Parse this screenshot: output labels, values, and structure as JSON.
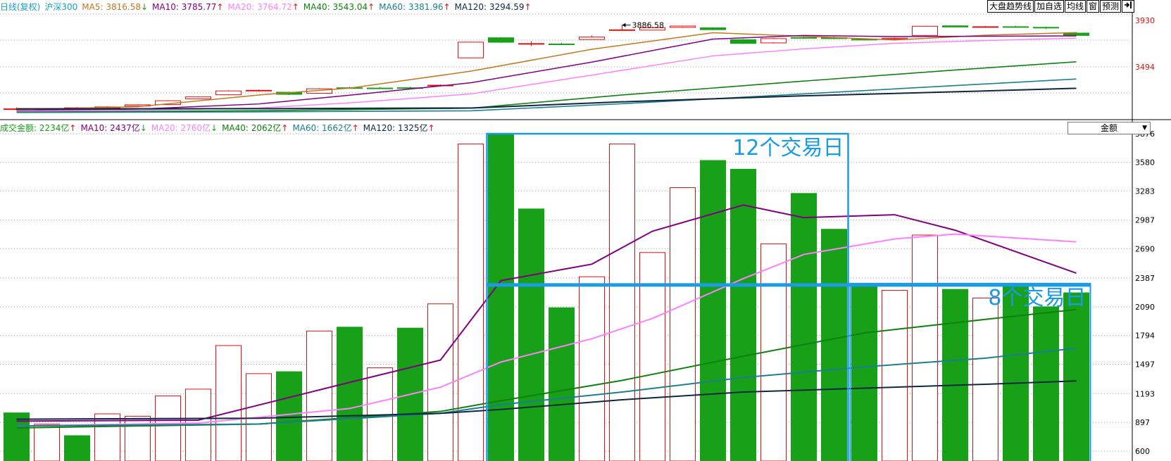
{
  "price_legend": [
    {
      "text": "日线(复权)",
      "color": "#1aa0c8",
      "arrow": "",
      "arrow_color": ""
    },
    {
      "text": "沪深300",
      "color": "#1aa0c8",
      "arrow": "",
      "arrow_color": ""
    },
    {
      "text": "MA5: 3816.58",
      "color": "#c07820",
      "arrow": "↓",
      "arrow_color": "#18a018"
    },
    {
      "text": "MA10: 3785.77",
      "color": "#800080",
      "arrow": "↑",
      "arrow_color": "#e01010"
    },
    {
      "text": "MA20: 3764.72",
      "color": "#ff80ff",
      "arrow": "↑",
      "arrow_color": "#e01010"
    },
    {
      "text": "MA40: 3543.04",
      "color": "#108010",
      "arrow": "↑",
      "arrow_color": "#e01010"
    },
    {
      "text": "MA60: 3381.96",
      "color": "#1a8090",
      "arrow": "↑",
      "arrow_color": "#e01010"
    },
    {
      "text": "MA120: 3294.59",
      "color": "#102840",
      "arrow": "↑",
      "arrow_color": "#e01010"
    }
  ],
  "volume_legend": [
    {
      "text": "成交金额: 2234亿",
      "color": "#18a018",
      "arrow": "↑",
      "arrow_color": "#e01010"
    },
    {
      "text": "MA10: 2437亿",
      "color": "#800080",
      "arrow": "↓",
      "arrow_color": "#18a018"
    },
    {
      "text": "MA20: 2760亿",
      "color": "#ff80ff",
      "arrow": "↓",
      "arrow_color": "#18a018"
    },
    {
      "text": "MA40: 2062亿",
      "color": "#108010",
      "arrow": "↑",
      "arrow_color": "#e01010"
    },
    {
      "text": "MA60: 1662亿",
      "color": "#1a8090",
      "arrow": "↑",
      "arrow_color": "#e01010"
    },
    {
      "text": "MA120: 1325亿",
      "color": "#102840",
      "arrow": "↑",
      "arrow_color": "#e01010"
    }
  ],
  "toolbar": {
    "trend_label": "大盘趋势线",
    "add_watch_label": "加自选",
    "avg_line_label": "均线",
    "window_label": "窗",
    "forecast_label": "预测",
    "exit_icon": "exit-arrow-icon"
  },
  "amount_select": {
    "value": "金额"
  },
  "colors": {
    "up": "#e01010",
    "down": "#18a018",
    "grid": "#a0a0a0",
    "axis_label": "#e01010",
    "annotation": "#1a9be6",
    "ma5": "#c07820",
    "ma10": "#800080",
    "ma20": "#ff80ff",
    "ma40": "#108010",
    "ma60": "#1a8090",
    "ma120": "#102840"
  },
  "chart_data": [
    {
      "type": "candlestick",
      "title": "",
      "y_axis_labels": [
        "3930",
        "3494"
      ],
      "ylim": [
        3080,
        3990
      ],
      "peak_label": "3886.58",
      "candles": [
        {
          "o": 3100,
          "c": 3102,
          "h": 3115,
          "l": 3088
        },
        {
          "o": 3096,
          "c": 3104,
          "h": 3110,
          "l": 3090
        },
        {
          "o": 3100,
          "c": 3112,
          "h": 3118,
          "l": 3094
        },
        {
          "o": 3110,
          "c": 3120,
          "h": 3126,
          "l": 3104
        },
        {
          "o": 3128,
          "c": 3140,
          "h": 3146,
          "l": 3122
        },
        {
          "o": 3142,
          "c": 3178,
          "h": 3184,
          "l": 3138
        },
        {
          "o": 3196,
          "c": 3214,
          "h": 3218,
          "l": 3192
        },
        {
          "o": 3234,
          "c": 3270,
          "h": 3276,
          "l": 3230
        },
        {
          "o": 3270,
          "c": 3276,
          "h": 3282,
          "l": 3264
        },
        {
          "o": 3258,
          "c": 3238,
          "h": 3262,
          "l": 3232
        },
        {
          "o": 3248,
          "c": 3290,
          "h": 3296,
          "l": 3244
        },
        {
          "o": 3300,
          "c": 3298,
          "h": 3310,
          "l": 3290
        },
        {
          "o": 3297,
          "c": 3296,
          "h": 3306,
          "l": 3288
        },
        {
          "o": 3300,
          "c": 3299,
          "h": 3310,
          "l": 3292
        },
        {
          "o": 3320,
          "c": 3324,
          "h": 3330,
          "l": 3314
        },
        {
          "o": 3580,
          "c": 3727,
          "h": 3730,
          "l": 3575
        },
        {
          "o": 3768,
          "c": 3726,
          "h": 3774,
          "l": 3720
        },
        {
          "o": 3714,
          "c": 3714,
          "h": 3736,
          "l": 3690
        },
        {
          "o": 3710,
          "c": 3709,
          "h": 3722,
          "l": 3700
        },
        {
          "o": 3752,
          "c": 3775,
          "h": 3790,
          "l": 3750
        },
        {
          "o": 3840,
          "c": 3843,
          "h": 3886.58,
          "l": 3836
        },
        {
          "o": 3840,
          "c": 3861,
          "h": 3866,
          "l": 3836
        },
        {
          "o": 3865,
          "c": 3878,
          "h": 3882,
          "l": 3860
        },
        {
          "o": 3861,
          "c": 3844,
          "h": 3866,
          "l": 3838
        },
        {
          "o": 3750,
          "c": 3715,
          "h": 3755,
          "l": 3710
        },
        {
          "o": 3720,
          "c": 3760,
          "h": 3766,
          "l": 3714
        },
        {
          "o": 3770,
          "c": 3769,
          "h": 3786,
          "l": 3760
        },
        {
          "o": 3770,
          "c": 3760,
          "h": 3780,
          "l": 3756
        },
        {
          "o": 3754,
          "c": 3747,
          "h": 3760,
          "l": 3742
        },
        {
          "o": 3756,
          "c": 3764,
          "h": 3770,
          "l": 3750
        },
        {
          "o": 3790,
          "c": 3876,
          "h": 3880,
          "l": 3786
        },
        {
          "o": 3880,
          "c": 3869,
          "h": 3884,
          "l": 3866
        },
        {
          "o": 3868,
          "c": 3872,
          "h": 3878,
          "l": 3862
        },
        {
          "o": 3872,
          "c": 3870,
          "h": 3880,
          "l": 3862
        },
        {
          "o": 3866,
          "c": 3860,
          "h": 3874,
          "l": 3850
        },
        {
          "o": 3812,
          "c": 3790,
          "h": 3822,
          "l": 3786
        }
      ],
      "ma_series": {
        "ma5": {
          "x": [
            0,
            4,
            8,
            11,
            15,
            19,
            23,
            26,
            29,
            32,
            35
          ],
          "y": [
            3095,
            3122,
            3232,
            3296,
            3455,
            3660,
            3815,
            3782,
            3748,
            3792,
            3816.58
          ]
        },
        "ma10": {
          "x": [
            0,
            4,
            8,
            11,
            15,
            19,
            23,
            26,
            29,
            32,
            35
          ],
          "y": [
            3086,
            3100,
            3148,
            3230,
            3346,
            3540,
            3756,
            3790,
            3779,
            3782,
            3785.77
          ]
        },
        "ma20": {
          "x": [
            0,
            4,
            8,
            11,
            15,
            19,
            23,
            26,
            29,
            32,
            35
          ],
          "y": [
            3082,
            3090,
            3110,
            3158,
            3242,
            3418,
            3598,
            3664,
            3716,
            3742,
            3764.72
          ]
        },
        "ma40": {
          "x": [
            0,
            8,
            15,
            20,
            26,
            31,
            35
          ],
          "y": [
            3072,
            3085,
            3108,
            3232,
            3362,
            3466,
            3543.04
          ]
        },
        "ma60": {
          "x": [
            0,
            8,
            15,
            20,
            26,
            31,
            35
          ],
          "y": [
            3068,
            3074,
            3084,
            3150,
            3242,
            3320,
            3381.96
          ]
        },
        "ma120": {
          "x": [
            0,
            8,
            15,
            20,
            26,
            31,
            35
          ],
          "y": [
            3102,
            3104,
            3110,
            3168,
            3224,
            3262,
            3294.59
          ]
        }
      }
    },
    {
      "type": "bar",
      "title": "",
      "y_axis_labels": [
        "3876",
        "3580",
        "3283",
        "2987",
        "2690",
        "2387",
        "2090",
        "1794",
        "1497",
        "1193",
        "897",
        "600"
      ],
      "ylim": [
        600,
        3876
      ],
      "values": [
        995,
        878,
        760,
        985,
        960,
        1170,
        1240,
        1690,
        1400,
        1420,
        1840,
        1880,
        1460,
        1870,
        2120,
        3770,
        3876,
        3100,
        2080,
        2400,
        3770,
        2650,
        3320,
        3600,
        3510,
        2740,
        3260,
        2890,
        2330,
        2260,
        2830,
        2270,
        2180,
        2330,
        2090,
        2234
      ],
      "direction": [
        "down",
        "up",
        "down",
        "up",
        "up",
        "up",
        "up",
        "up",
        "up",
        "down",
        "up",
        "down",
        "up",
        "down",
        "up",
        "up",
        "down",
        "down",
        "down",
        "up",
        "up",
        "up",
        "up",
        "down",
        "down",
        "up",
        "down",
        "down",
        "down",
        "up",
        "up",
        "down",
        "up",
        "down",
        "down",
        "down"
      ],
      "ma_series": {
        "ma10": {
          "x": [
            0,
            6,
            11,
            14,
            16,
            19,
            21,
            24,
            26,
            29,
            31,
            35
          ],
          "y": [
            910,
            920,
            1310,
            1540,
            2360,
            2530,
            2870,
            3140,
            3010,
            3040,
            2880,
            2437
          ]
        },
        "ma20": {
          "x": [
            0,
            6,
            11,
            14,
            16,
            19,
            21,
            24,
            26,
            29,
            31,
            35
          ],
          "y": [
            860,
            890,
            1040,
            1260,
            1520,
            1760,
            1970,
            2380,
            2630,
            2790,
            2840,
            2760
          ]
        },
        "ma40": {
          "x": [
            0,
            8,
            14,
            16,
            20,
            24,
            28,
            32,
            35
          ],
          "y": [
            840,
            880,
            1010,
            1120,
            1330,
            1580,
            1820,
            1960,
            2062
          ]
        },
        "ma60": {
          "x": [
            0,
            8,
            14,
            16,
            20,
            24,
            28,
            32,
            35
          ],
          "y": [
            860,
            880,
            990,
            1080,
            1210,
            1360,
            1470,
            1560,
            1662
          ]
        },
        "ma120": {
          "x": [
            0,
            8,
            14,
            16,
            20,
            24,
            28,
            32,
            35
          ],
          "y": [
            930,
            940,
            990,
            1030,
            1130,
            1210,
            1250,
            1290,
            1325
          ]
        }
      },
      "annotations": [
        {
          "label": "12个交易日",
          "start": 16,
          "end": 27,
          "top_value": 3876
        },
        {
          "label": "8个交易日",
          "start": 28,
          "end": 35,
          "top_value": 2330
        }
      ]
    }
  ]
}
